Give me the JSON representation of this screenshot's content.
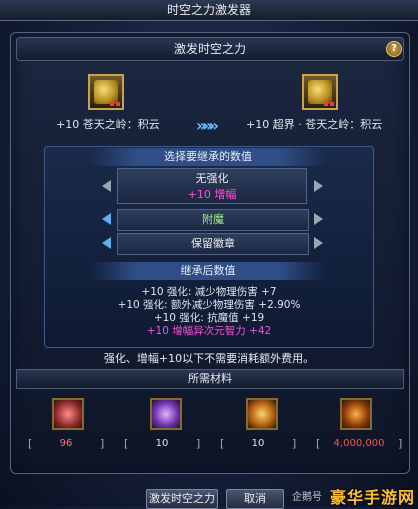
{
  "window": {
    "title": "时空之力激发器"
  },
  "dialog": {
    "header": "激发时空之力",
    "help_icon": "?"
  },
  "source_item": {
    "name": "+10 苍天之岭：积云",
    "icon": "ring-icon"
  },
  "target_item": {
    "name": "+10 超界 · 苍天之岭：积云",
    "icon": "ring-icon"
  },
  "transfer_arrows": "»»»",
  "select_panel": {
    "header": "选择要继承的数值",
    "options": [
      {
        "line1": "无强化",
        "line2": "+10 增幅",
        "accent": "#ff4fd8"
      },
      {
        "label": "附魔",
        "color": "#9ef58a"
      },
      {
        "label": "保留徽章",
        "color": "#e8ecf3"
      }
    ]
  },
  "result_panel": {
    "header": "继承后数值",
    "stats": [
      {
        "text": "+10 强化: 减少物理伤害 +7",
        "color": "#e0e4ea"
      },
      {
        "text": "+10 强化: 额外减少物理伤害 +2.90%",
        "color": "#e0e4ea"
      },
      {
        "text": "+10 强化: 抗魔值 +19",
        "color": "#e0e4ea"
      },
      {
        "text": "+10 增幅异次元智力 +42",
        "color": "#ff4fd8"
      }
    ]
  },
  "note": "强化、增幅+10以下不需要消耗额外费用。",
  "materials": {
    "header": "所需材料",
    "items": [
      {
        "icon": "red-crystal-icon",
        "count": "96",
        "color": "#ff7070"
      },
      {
        "icon": "purple-orb-icon",
        "count": "10",
        "color": "#e0e4ea"
      },
      {
        "icon": "time-rune-icon",
        "count": "10",
        "color": "#e0e4ea"
      },
      {
        "icon": "gold-coins-icon",
        "count": "4,000,000",
        "color": "#ff5050"
      }
    ]
  },
  "buttons": {
    "activate": "激发时空之力",
    "cancel": "取消"
  },
  "watermark": {
    "text": "豪华手游网",
    "prefix": "企鹅号"
  }
}
